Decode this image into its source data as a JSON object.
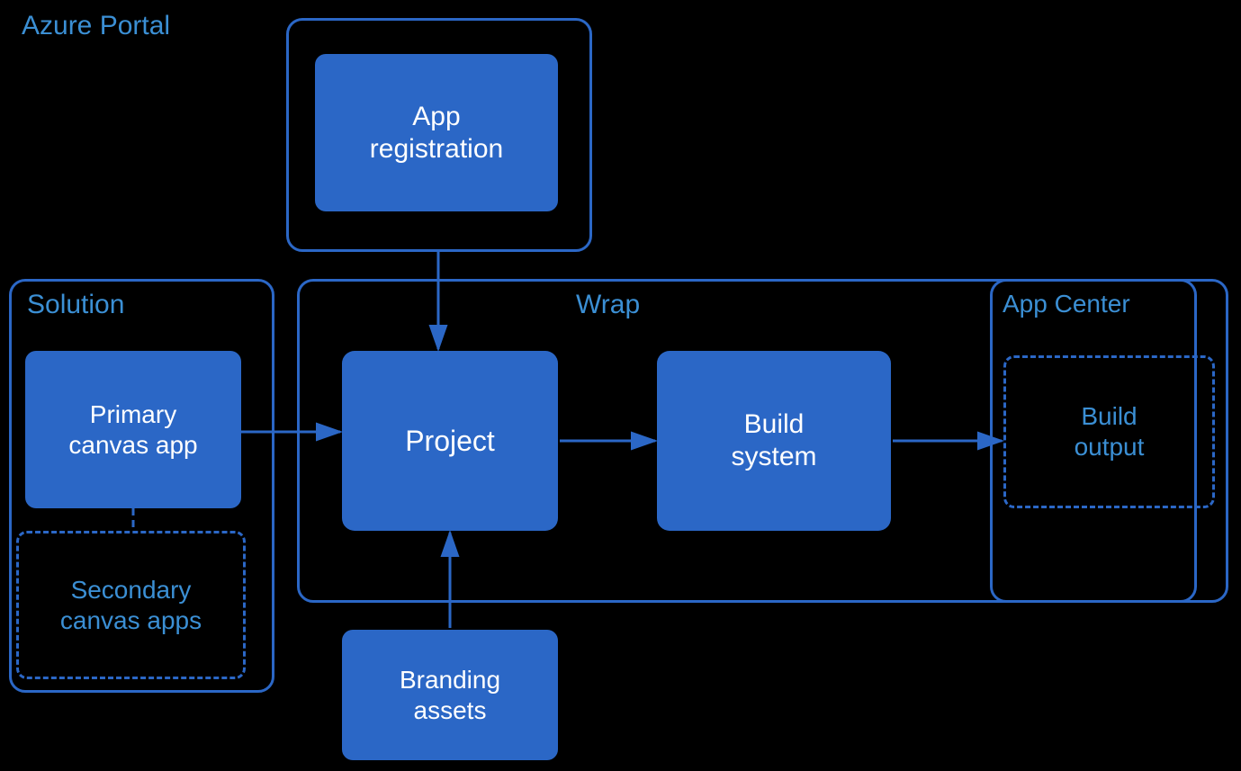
{
  "diagram": {
    "background": "#000000",
    "azure_portal": {
      "label": "Azure Portal",
      "app_registration": "App\nregistration"
    },
    "solution": {
      "label": "Solution",
      "primary_canvas": "Primary\ncanvas app",
      "secondary_canvas": "Secondary\ncanvas apps"
    },
    "wrap": {
      "label": "Wrap",
      "project": "Project",
      "build_system": "Build\nsystem"
    },
    "app_center": {
      "label": "App Center",
      "build_output": "Build\noutput"
    },
    "branding_assets": "Branding\nassets"
  }
}
